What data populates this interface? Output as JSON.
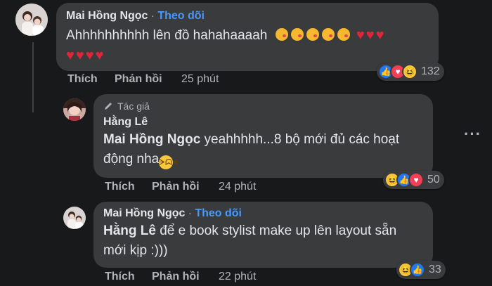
{
  "comment1": {
    "author": "Mai Hồng Ngọc",
    "dot": "·",
    "follow": "Theo dõi",
    "text": "Ahhhhhhhhhh lên đồ hahahaaaah",
    "like_label": "Thích",
    "reply_label": "Phản hồi",
    "time": "25 phút",
    "reaction_count": "132",
    "reactions": [
      "like-icon",
      "love-icon",
      "haha-icon"
    ]
  },
  "reply1": {
    "badge": "Tác giả",
    "author": "Hằng Lê",
    "mention": "Mai Hồng Ngọc",
    "text_line1": " yeahhhhh...8 bộ mới đủ các hoạt",
    "text_line2": "động nha",
    "like_label": "Thích",
    "reply_label": "Phản hồi",
    "time": "24 phút",
    "reaction_count": "50",
    "reactions": [
      "haha-icon",
      "like-icon",
      "love-icon"
    ],
    "more": "···"
  },
  "reply2": {
    "author": "Mai Hồng Ngọc",
    "dot": "·",
    "follow": "Theo dõi",
    "mention": "Hằng Lê",
    "text_line1": " để e book stylist make up lên layout sẵn",
    "text_line2": "mới kịp :)))",
    "like_label": "Thích",
    "reply_label": "Phản hồi",
    "time": "22 phút",
    "reaction_count": "33",
    "reactions": [
      "haha-icon",
      "like-icon"
    ]
  }
}
